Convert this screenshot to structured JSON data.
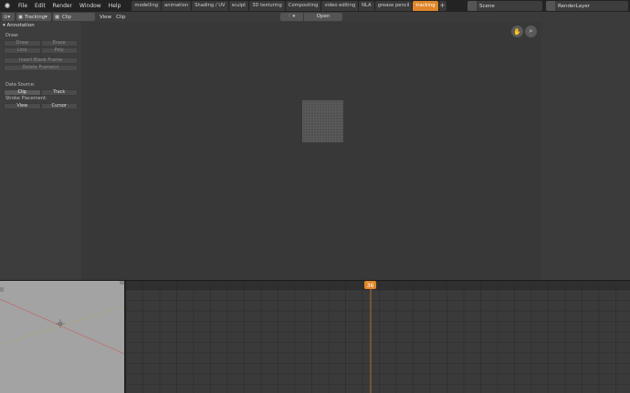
{
  "app": {
    "logo_glyph": "✺",
    "menu": [
      "File",
      "Edit",
      "Render",
      "Window",
      "Help"
    ]
  },
  "workspaces": {
    "tabs": [
      "modelling",
      "animation",
      "Shading / UV",
      "sculpt",
      "3D texturing",
      "Compositing",
      "video editing",
      "NLA",
      "grease pencil",
      "tracking"
    ],
    "active": "tracking",
    "add_label": "+"
  },
  "scene": {
    "label": "Scene"
  },
  "render_layer": {
    "label": "RenderLayer"
  },
  "clip_header": {
    "editor_type": "Tracking",
    "clip_mode": "Clip",
    "menus": [
      "View",
      "Clip"
    ],
    "open_label": "Open"
  },
  "sidebar": {
    "panel_title": "Annotation",
    "draw_label": "Draw:",
    "draw_buttons": [
      "Draw",
      "Erase",
      "Line",
      "Poly"
    ],
    "insert_blank": "Insert Blank Frame",
    "delete_frames": "Delete Frame(s)",
    "data_source_label": "Data Source:",
    "data_source": [
      "Clip",
      "Track"
    ],
    "stroke_label": "Stroke Placement:",
    "stroke": [
      "View",
      "Cursor"
    ]
  },
  "viewport": {
    "nav_icons": [
      "hand-pan-icon",
      "zoom-icon"
    ]
  },
  "timeline": {
    "current_frame": "36"
  },
  "colors": {
    "accent": "#e0862a",
    "playhead": "#e0862a"
  }
}
